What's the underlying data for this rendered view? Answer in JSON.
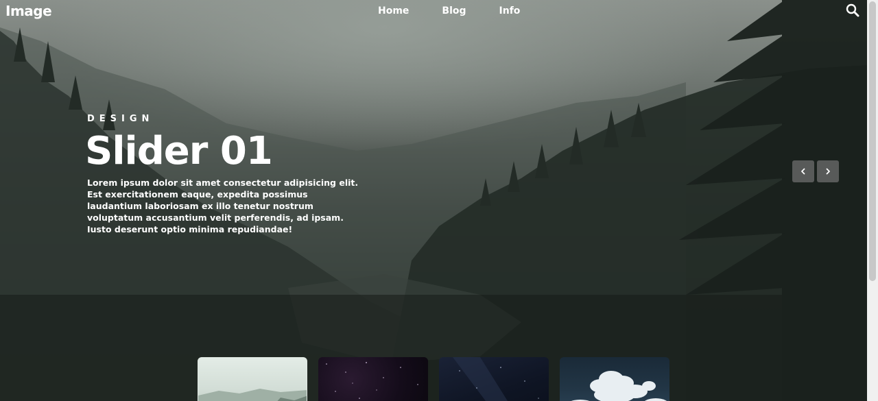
{
  "brand": {
    "logo": "Image"
  },
  "nav": {
    "items": [
      {
        "label": "Home"
      },
      {
        "label": "Blog"
      },
      {
        "label": "Info"
      }
    ]
  },
  "search": {
    "icon": "search-icon"
  },
  "hero": {
    "eyebrow": "DESIGN",
    "title": "Slider 01",
    "description": "Lorem ipsum dolor sit amet consectetur adipisicing elit. Est exercitationem eaque, expedita possimus laudantium laboriosam ex illo tenetur nostrum voluptatum accusantium velit perferendis, ad ipsam. Iusto deserunt optio minima repudiandae!"
  },
  "slider": {
    "prev_icon": "chevron-left-icon",
    "next_icon": "chevron-right-icon",
    "active_index": 0,
    "thumbnails": [
      {
        "scene": "misty-forest"
      },
      {
        "scene": "purple-starfield"
      },
      {
        "scene": "night-sky"
      },
      {
        "scene": "clouds"
      }
    ]
  },
  "colors": {
    "text": "#ffffff",
    "arrow_bg": "#6e6e6e",
    "background_dark": "#1c231f",
    "fog": "#8a908b"
  }
}
